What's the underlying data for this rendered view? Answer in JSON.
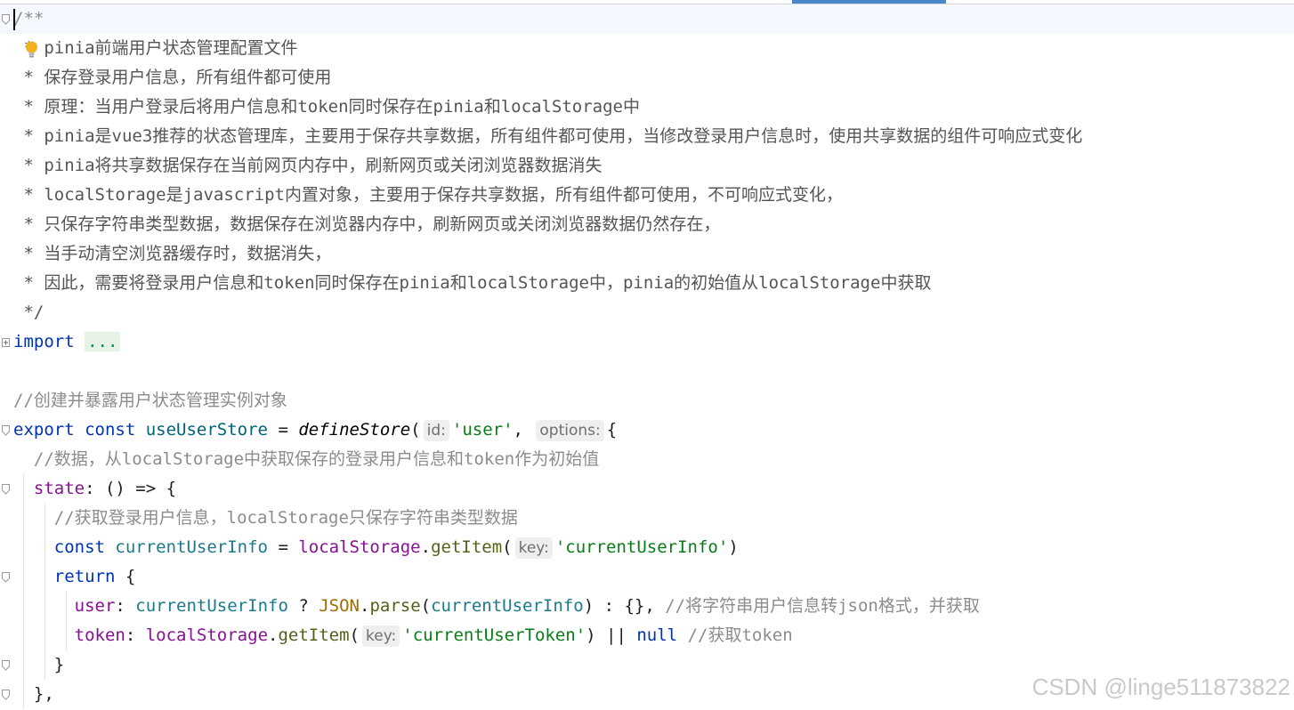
{
  "editor": {
    "lines": [
      {
        "id": "l1",
        "parts": [
          {
            "c": "cm",
            "t": "/**"
          }
        ]
      },
      {
        "id": "l2",
        "parts": [
          {
            "c": "doc",
            "t": " * "
          },
          {
            "c": "doc",
            "t": "pinia前端用户状态管理配置文件"
          }
        ]
      },
      {
        "id": "l3",
        "parts": [
          {
            "c": "doc",
            "t": " * 保存登录用户信息，所有组件都可使用"
          }
        ]
      },
      {
        "id": "l4",
        "parts": [
          {
            "c": "doc",
            "t": " * 原理：当用户登录后将用户信息和token同时保存在pinia和localStorage中"
          }
        ]
      },
      {
        "id": "l5",
        "parts": [
          {
            "c": "doc",
            "t": " * pinia是vue3推荐的状态管理库，主要用于保存共享数据，所有组件都可使用，当修改登录用户信息时，使用共享数据的组件可响应式变化"
          }
        ]
      },
      {
        "id": "l6",
        "parts": [
          {
            "c": "doc",
            "t": " * pinia将共享数据保存在当前网页内存中，刷新网页或关闭浏览器数据消失"
          }
        ]
      },
      {
        "id": "l7",
        "parts": [
          {
            "c": "doc",
            "t": " * localStorage是javascript内置对象，主要用于保存共享数据，所有组件都可使用，不可响应式变化，"
          }
        ]
      },
      {
        "id": "l8",
        "parts": [
          {
            "c": "doc",
            "t": " * 只保存字符串类型数据，数据保存在浏览器内存中，刷新网页或关闭浏览器数据仍然存在，"
          }
        ]
      },
      {
        "id": "l9",
        "parts": [
          {
            "c": "doc",
            "t": " * 当手动清空浏览器缓存时，数据消失，"
          }
        ]
      },
      {
        "id": "l10",
        "parts": [
          {
            "c": "doc",
            "t": " * 因此，需要将登录用户信息和token同时保存在pinia和localStorage中，pinia的初始值从localStorage中获取"
          }
        ]
      },
      {
        "id": "l11",
        "parts": [
          {
            "c": "doc",
            "t": " */"
          }
        ]
      },
      {
        "id": "l12",
        "parts": [
          {
            "c": "kw",
            "t": "import"
          },
          {
            "c": "txt",
            "t": " "
          },
          {
            "c": "folded",
            "t": "..."
          }
        ]
      },
      {
        "id": "l13",
        "parts": []
      },
      {
        "id": "l14",
        "parts": [
          {
            "c": "cm",
            "t": "//创建并暴露用户状态管理实例对象"
          }
        ]
      },
      {
        "id": "l15",
        "parts": [
          {
            "c": "kw",
            "t": "export const "
          },
          {
            "c": "fn",
            "t": "useUserStore"
          },
          {
            "c": "txt",
            "t": " = "
          },
          {
            "c": "call",
            "t": "defineStore"
          },
          {
            "c": "txt",
            "t": "("
          },
          {
            "c": "hint",
            "t": "id:"
          },
          {
            "c": "str",
            "t": "'user'"
          },
          {
            "c": "txt",
            "t": ", "
          },
          {
            "c": "hint",
            "t": "options:"
          },
          {
            "c": "txt",
            "t": "{"
          }
        ]
      },
      {
        "id": "l16",
        "parts": [
          {
            "c": "cm",
            "t": "  //数据，从localStorage中获取保存的登录用户信息和token作为初始值"
          }
        ]
      },
      {
        "id": "l17",
        "parts": [
          {
            "c": "txt",
            "t": "  "
          },
          {
            "c": "prop",
            "t": "state"
          },
          {
            "c": "txt",
            "t": ": () => {"
          }
        ]
      },
      {
        "id": "l18",
        "parts": [
          {
            "c": "cm",
            "t": "    //获取登录用户信息，localStorage只保存字符串类型数据"
          }
        ]
      },
      {
        "id": "l19",
        "parts": [
          {
            "c": "txt",
            "t": "    "
          },
          {
            "c": "kw",
            "t": "const "
          },
          {
            "c": "var",
            "t": "currentUserInfo"
          },
          {
            "c": "txt",
            "t": " = "
          },
          {
            "c": "glob",
            "t": "localStorage"
          },
          {
            "c": "txt",
            "t": "."
          },
          {
            "c": "method",
            "t": "getItem"
          },
          {
            "c": "txt",
            "t": "("
          },
          {
            "c": "hint",
            "t": "key:"
          },
          {
            "c": "str",
            "t": "'currentUserInfo'"
          },
          {
            "c": "txt",
            "t": ")"
          }
        ]
      },
      {
        "id": "l20",
        "parts": [
          {
            "c": "txt",
            "t": "    "
          },
          {
            "c": "kw",
            "t": "return"
          },
          {
            "c": "txt",
            "t": " {"
          }
        ]
      },
      {
        "id": "l21",
        "parts": [
          {
            "c": "txt",
            "t": "      "
          },
          {
            "c": "prop",
            "t": "user"
          },
          {
            "c": "txt",
            "t": ": "
          },
          {
            "c": "var",
            "t": "currentUserInfo"
          },
          {
            "c": "txt",
            "t": " ? "
          },
          {
            "c": "cls",
            "t": "JSON"
          },
          {
            "c": "txt",
            "t": "."
          },
          {
            "c": "method",
            "t": "parse"
          },
          {
            "c": "txt",
            "t": "("
          },
          {
            "c": "var",
            "t": "currentUserInfo"
          },
          {
            "c": "txt",
            "t": ") : {}, "
          },
          {
            "c": "cm",
            "t": "//将字符串用户信息转json格式，并获取"
          }
        ]
      },
      {
        "id": "l22",
        "parts": [
          {
            "c": "txt",
            "t": "      "
          },
          {
            "c": "prop",
            "t": "token"
          },
          {
            "c": "txt",
            "t": ": "
          },
          {
            "c": "glob",
            "t": "localStorage"
          },
          {
            "c": "txt",
            "t": "."
          },
          {
            "c": "method",
            "t": "getItem"
          },
          {
            "c": "txt",
            "t": "("
          },
          {
            "c": "hint",
            "t": "key:"
          },
          {
            "c": "str",
            "t": "'currentUserToken'"
          },
          {
            "c": "txt",
            "t": ") || "
          },
          {
            "c": "kw",
            "t": "null"
          },
          {
            "c": "txt",
            "t": " "
          },
          {
            "c": "cm",
            "t": "//获取token"
          }
        ]
      },
      {
        "id": "l23",
        "parts": [
          {
            "c": "txt",
            "t": "    }"
          }
        ]
      },
      {
        "id": "l24",
        "parts": [
          {
            "c": "txt",
            "t": "  },"
          }
        ]
      }
    ]
  },
  "watermark": "CSDN @linge511873822",
  "colors": {
    "keyword": "#0033b3",
    "string": "#067d17",
    "comment": "#8c8c8c",
    "property": "#871094",
    "accent_tab": "#4a86c8"
  }
}
